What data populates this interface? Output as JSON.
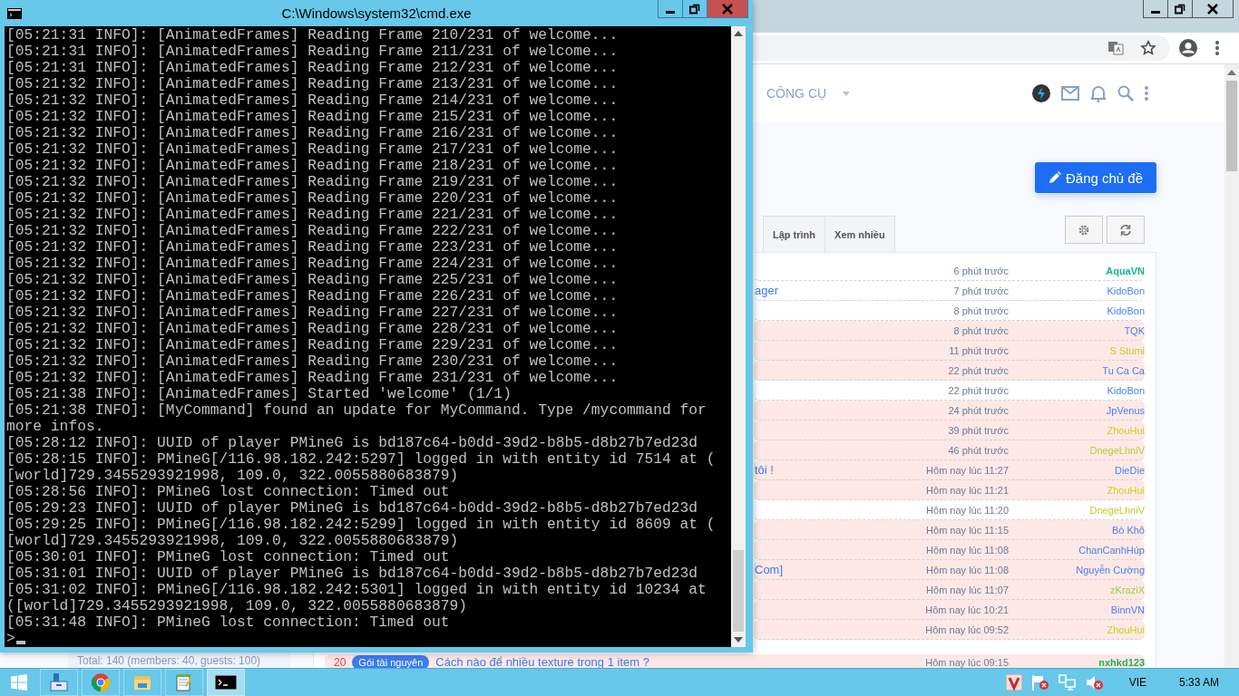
{
  "browser": {
    "nav_item": "CÔNG CỤ",
    "post_button": "Đăng chủ đề",
    "tabs": [
      {
        "label": "Lập trình",
        "selected": false
      },
      {
        "label": "Xem nhiều",
        "selected": false
      }
    ],
    "threads": [
      {
        "time": "6 phút trước",
        "user": "AquaVN",
        "color": "#13b795",
        "user_bold": true,
        "highlighted": false
      },
      {
        "title": "ager",
        "time": "7 phút trước",
        "user": "KidoBon",
        "color": "#4a80f0",
        "user_bold": false,
        "highlighted": false
      },
      {
        "time": "8 phút trước",
        "user": "KidoBon",
        "color": "#4a80f0",
        "user_bold": false,
        "highlighted": false
      },
      {
        "time": "8 phút trước",
        "user": "TQK",
        "color": "#4a80f0",
        "user_bold": false,
        "highlighted": true
      },
      {
        "time": "11 phút trước",
        "user": "S Stumi",
        "color": "#c2cf2a",
        "user_bold": false,
        "highlighted": true
      },
      {
        "time": "22 phút trước",
        "user": "Tu Ca Ca",
        "color": "#4a80f0",
        "user_bold": false,
        "highlighted": true
      },
      {
        "time": "22 phút trước",
        "user": "KidoBon",
        "color": "#4a80f0",
        "user_bold": false,
        "highlighted": false
      },
      {
        "time": "24 phút trước",
        "user": "JpVenus",
        "color": "#4a80f0",
        "user_bold": false,
        "highlighted": true
      },
      {
        "time": "39 phút trước",
        "user": "ZhouHui",
        "color": "#cfcf1f",
        "user_bold": false,
        "highlighted": true
      },
      {
        "time": "46 phút trước",
        "user": "DnegeLhniV",
        "color": "#b5d02c",
        "user_bold": false,
        "highlighted": true
      },
      {
        "title": "tôi !",
        "time": "Hôm nay lúc 11:27",
        "user": "DieDie",
        "color": "#4a80f0",
        "user_bold": false,
        "highlighted": true
      },
      {
        "time": "Hôm nay lúc 11:21",
        "user": "ZhouHui",
        "color": "#cfcf1f",
        "user_bold": false,
        "highlighted": true
      },
      {
        "time": "Hôm nay lúc 11:20",
        "user": "DnegeLhniV",
        "color": "#b5d02c",
        "user_bold": false,
        "highlighted": false
      },
      {
        "time": "Hôm nay lúc 11:15",
        "user": "Bò Khô",
        "color": "#4a80f0",
        "user_bold": false,
        "highlighted": true
      },
      {
        "time": "Hôm nay lúc 11:08",
        "user": "ChanCanhHúp",
        "color": "#4a80f0",
        "user_bold": false,
        "highlighted": true
      },
      {
        "title": "Com]",
        "time": "Hôm nay lúc 11:08",
        "user": "Nguyễn Cường",
        "color": "#4a80f0",
        "user_bold": false,
        "highlighted": true
      },
      {
        "time": "Hôm nay lúc 11:07",
        "user": "zKraziX",
        "color": "#a3cc3a",
        "user_bold": false,
        "highlighted": true
      },
      {
        "time": "Hôm nay lúc 10:21",
        "user": "BinnVN",
        "color": "#4a80f0",
        "user_bold": false,
        "highlighted": true
      },
      {
        "time": "Hôm nay lúc 09:52",
        "user": "ZhouHui",
        "color": "#cfcf1f",
        "user_bold": false,
        "highlighted": true
      },
      {
        "number": "20",
        "tag": "Gói tài nguyên",
        "title": "Cách nào để nhiều texture trong 1 item ?",
        "time": "Hôm nay lúc 09:15",
        "user": "nxhkd123",
        "color": "#22b14c",
        "user_bold": true,
        "highlighted": true
      }
    ],
    "online": "Total: 140 (members: 40, guests: 100)"
  },
  "cmd_window": {
    "title": "C:\\Windows\\system32\\cmd.exe",
    "lines": [
      "[05:21:31 INFO]: [AnimatedFrames] Reading Frame 210/231 of welcome...",
      "[05:21:31 INFO]: [AnimatedFrames] Reading Frame 211/231 of welcome...",
      "[05:21:31 INFO]: [AnimatedFrames] Reading Frame 212/231 of welcome...",
      "[05:21:32 INFO]: [AnimatedFrames] Reading Frame 213/231 of welcome...",
      "[05:21:32 INFO]: [AnimatedFrames] Reading Frame 214/231 of welcome...",
      "[05:21:32 INFO]: [AnimatedFrames] Reading Frame 215/231 of welcome...",
      "[05:21:32 INFO]: [AnimatedFrames] Reading Frame 216/231 of welcome...",
      "[05:21:32 INFO]: [AnimatedFrames] Reading Frame 217/231 of welcome...",
      "[05:21:32 INFO]: [AnimatedFrames] Reading Frame 218/231 of welcome...",
      "[05:21:32 INFO]: [AnimatedFrames] Reading Frame 219/231 of welcome...",
      "[05:21:32 INFO]: [AnimatedFrames] Reading Frame 220/231 of welcome...",
      "[05:21:32 INFO]: [AnimatedFrames] Reading Frame 221/231 of welcome...",
      "[05:21:32 INFO]: [AnimatedFrames] Reading Frame 222/231 of welcome...",
      "[05:21:32 INFO]: [AnimatedFrames] Reading Frame 223/231 of welcome...",
      "[05:21:32 INFO]: [AnimatedFrames] Reading Frame 224/231 of welcome...",
      "[05:21:32 INFO]: [AnimatedFrames] Reading Frame 225/231 of welcome...",
      "[05:21:32 INFO]: [AnimatedFrames] Reading Frame 226/231 of welcome...",
      "[05:21:32 INFO]: [AnimatedFrames] Reading Frame 227/231 of welcome...",
      "[05:21:32 INFO]: [AnimatedFrames] Reading Frame 228/231 of welcome...",
      "[05:21:32 INFO]: [AnimatedFrames] Reading Frame 229/231 of welcome...",
      "[05:21:32 INFO]: [AnimatedFrames] Reading Frame 230/231 of welcome...",
      "[05:21:32 INFO]: [AnimatedFrames] Reading Frame 231/231 of welcome...",
      "[05:21:38 INFO]: [AnimatedFrames] Started 'welcome' (1/1)",
      "[05:21:38 INFO]: [MyCommand] found an update for MyCommand. Type /mycommand for",
      "more infos.",
      "[05:28:12 INFO]: UUID of player PMineG is bd187c64-b0dd-39d2-b8b5-d8b27b7ed23d",
      "[05:28:15 INFO]: PMineG[/116.98.182.242:5297] logged in with entity id 7514 at (",
      "[world]729.3455293921998, 109.0, 322.0055880683879)",
      "[05:28:56 INFO]: PMineG lost connection: Timed out",
      "[05:29:23 INFO]: UUID of player PMineG is bd187c64-b0dd-39d2-b8b5-d8b27b7ed23d",
      "[05:29:25 INFO]: PMineG[/116.98.182.242:5299] logged in with entity id 8609 at (",
      "[world]729.3455293921998, 109.0, 322.0055880683879)",
      "[05:30:01 INFO]: PMineG lost connection: Timed out",
      "[05:31:01 INFO]: UUID of player PMineG is bd187c64-b0dd-39d2-b8b5-d8b27b7ed23d",
      "[05:31:02 INFO]: PMineG[/116.98.182.242:5301] logged in with entity id 10234 at",
      "([world]729.3455293921998, 109.0, 322.0055880683879)",
      "[05:31:48 INFO]: PMineG lost connection: Timed out"
    ],
    "prompt": ">"
  },
  "taskbar": {
    "apps": [
      {
        "kind": "server",
        "selected": false
      },
      {
        "kind": "chrome",
        "selected": false
      },
      {
        "kind": "explorer",
        "selected": false
      },
      {
        "kind": "notepad",
        "selected": false
      },
      {
        "kind": "console",
        "selected": true
      }
    ],
    "language": "VIE",
    "clock": "5:33 AM"
  }
}
